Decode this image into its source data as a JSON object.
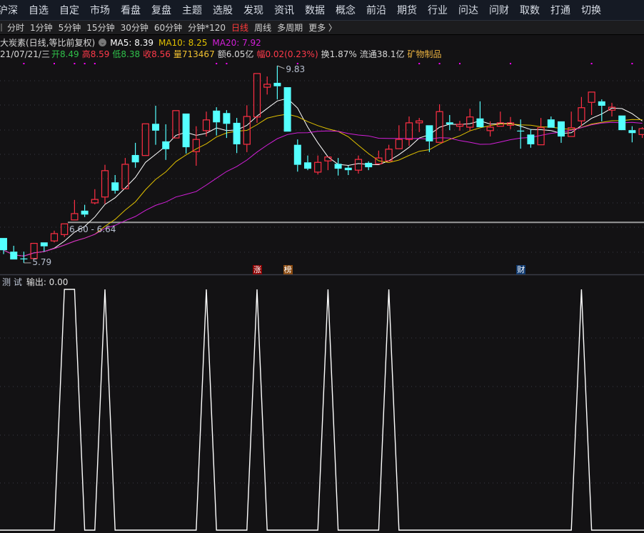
{
  "menu": [
    "沪深",
    "自选",
    "自定",
    "市场",
    "看盘",
    "复盘",
    "主题",
    "选股",
    "发现",
    "资讯",
    "数据",
    "概念",
    "前沿",
    "期货",
    "行业",
    "问达",
    "问财",
    "取数",
    "打通",
    "切换"
  ],
  "periods": {
    "items": [
      "分时",
      "1分钟",
      "5分钟",
      "15分钟",
      "30分钟",
      "60分钟",
      "分钟*120",
      "日线",
      "周线",
      "多周期",
      "更多 〉"
    ],
    "active": "日线"
  },
  "stock": {
    "name": "大炭素(日线,等比前复权)",
    "ma5": "MA5: 8.39",
    "ma10": "MA10: 8.25",
    "ma20": "MA20: 7.92"
  },
  "quote": {
    "date": "21/07/21/三",
    "open": "开8.49",
    "high": "高8.59",
    "low": "低8.38",
    "close": "收8.56",
    "volume": "量713467",
    "amount": "额6.05亿",
    "change": "幅0.02(0.23%)",
    "turnover": "换1.87%",
    "float": "流通38.1亿",
    "industry": "矿物制品"
  },
  "annotations": {
    "max_label": "9.83",
    "min_label": "5.79",
    "range_label": "6.60 - 6.64",
    "range_price": 6.62
  },
  "badges": [
    {
      "text": "涨",
      "color": "#8b0000",
      "day": 25
    },
    {
      "text": "榜",
      "color": "#8a4a10",
      "day": 28
    },
    {
      "text": "财",
      "color": "#103a70",
      "day": 51
    }
  ],
  "event_days": [
    2,
    5,
    7,
    8,
    9,
    21,
    22,
    29,
    41,
    43,
    45,
    50,
    58,
    62
  ],
  "colors": {
    "up": "#ff2f44",
    "down": "#54ffff",
    "ma5": "#ffffff",
    "ma10": "#e0c000",
    "ma20": "#d21fd8",
    "event": "#ff00ff"
  },
  "indicator": {
    "title": "测 试",
    "output": "输出: 0.00",
    "values_one_days": [
      6,
      7,
      10,
      20,
      25,
      32,
      38,
      57
    ],
    "ylim": [
      0,
      1
    ]
  },
  "chart_data": {
    "type": "candlestick",
    "ylim": [
      5.6,
      9.96
    ],
    "ohlc": [
      [
        6.3,
        6.3,
        5.97,
        6.05
      ],
      [
        6.02,
        6.14,
        5.86,
        5.86
      ],
      [
        5.88,
        6.02,
        5.79,
        5.88
      ],
      [
        5.88,
        6.2,
        5.88,
        6.19
      ],
      [
        6.21,
        6.21,
        6.02,
        6.13
      ],
      [
        6.24,
        6.45,
        6.21,
        6.39
      ],
      [
        6.37,
        6.59,
        6.32,
        6.59
      ],
      [
        6.67,
        7.08,
        6.67,
        6.8
      ],
      [
        6.86,
        6.98,
        6.73,
        6.78
      ],
      [
        7.02,
        7.3,
        6.99,
        7.09
      ],
      [
        7.14,
        7.8,
        7.0,
        7.68
      ],
      [
        7.44,
        7.59,
        7.21,
        7.27
      ],
      [
        7.31,
        7.94,
        7.31,
        7.81
      ],
      [
        8.0,
        8.25,
        7.74,
        7.85
      ],
      [
        7.99,
        8.64,
        7.99,
        8.64
      ],
      [
        8.64,
        9.01,
        8.21,
        8.5
      ],
      [
        8.28,
        8.63,
        7.9,
        8.12
      ],
      [
        8.35,
        8.91,
        8.35,
        8.91
      ],
      [
        8.85,
        8.85,
        8.03,
        8.16
      ],
      [
        8.07,
        8.59,
        7.78,
        8.32
      ],
      [
        8.5,
        8.89,
        8.38,
        8.72
      ],
      [
        8.91,
        8.98,
        8.4,
        8.67
      ],
      [
        8.86,
        8.92,
        8.35,
        8.64
      ],
      [
        8.66,
        8.76,
        8.04,
        8.22
      ],
      [
        8.22,
        9.02,
        8.06,
        8.79
      ],
      [
        8.78,
        9.67,
        8.66,
        9.67
      ],
      [
        9.39,
        9.61,
        9.24,
        9.45
      ],
      [
        9.48,
        9.83,
        9.14,
        9.41
      ],
      [
        9.39,
        9.39,
        8.48,
        8.48
      ],
      [
        8.21,
        8.32,
        7.66,
        7.8
      ],
      [
        7.85,
        7.99,
        7.69,
        7.72
      ],
      [
        7.65,
        7.99,
        7.6,
        7.85
      ],
      [
        7.88,
        7.96,
        7.69,
        7.96
      ],
      [
        7.82,
        7.94,
        7.58,
        7.72
      ],
      [
        7.74,
        7.78,
        7.59,
        7.69
      ],
      [
        7.69,
        7.99,
        7.62,
        7.91
      ],
      [
        7.84,
        7.87,
        7.69,
        7.75
      ],
      [
        7.82,
        8.09,
        7.82,
        7.94
      ],
      [
        7.88,
        8.21,
        7.88,
        8.12
      ],
      [
        8.13,
        8.61,
        8.13,
        8.32
      ],
      [
        8.32,
        8.79,
        8.19,
        8.66
      ],
      [
        8.66,
        8.76,
        8.47,
        8.7
      ],
      [
        8.61,
        8.61,
        8.06,
        8.28
      ],
      [
        8.26,
        9.04,
        8.26,
        8.89
      ],
      [
        8.67,
        8.82,
        8.51,
        8.63
      ],
      [
        8.59,
        8.7,
        8.5,
        8.63
      ],
      [
        8.57,
        8.95,
        8.5,
        8.78
      ],
      [
        8.75,
        9.1,
        8.57,
        8.57
      ],
      [
        8.5,
        8.69,
        8.38,
        8.57
      ],
      [
        8.59,
        8.89,
        8.59,
        8.66
      ],
      [
        8.61,
        8.78,
        8.53,
        8.66
      ],
      [
        8.5,
        8.73,
        8.13,
        8.5
      ],
      [
        8.42,
        8.53,
        8.15,
        8.22
      ],
      [
        8.21,
        8.76,
        8.21,
        8.56
      ],
      [
        8.73,
        8.79,
        8.56,
        8.56
      ],
      [
        8.69,
        8.69,
        8.25,
        8.38
      ],
      [
        8.38,
        8.89,
        8.38,
        8.56
      ],
      [
        8.7,
        9.19,
        8.59,
        8.97
      ],
      [
        9.08,
        9.29,
        8.82,
        9.29
      ],
      [
        9.1,
        9.14,
        8.69,
        9.01
      ],
      [
        8.92,
        9.07,
        8.79,
        8.98
      ],
      [
        8.81,
        8.81,
        8.51,
        8.51
      ],
      [
        8.51,
        8.59,
        8.26,
        8.45
      ],
      [
        8.42,
        8.57,
        8.35,
        8.54
      ]
    ],
    "ohlc_order": [
      "open",
      "high",
      "low",
      "close"
    ],
    "series": [
      {
        "name": "MA5",
        "window": 5
      },
      {
        "name": "MA10",
        "window": 10
      },
      {
        "name": "MA20",
        "window": 20
      }
    ],
    "grid": true
  }
}
